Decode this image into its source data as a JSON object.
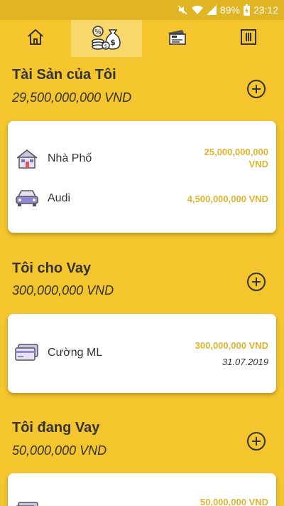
{
  "status_bar": {
    "battery": "89%",
    "time": "23:12"
  },
  "tabs": [
    {
      "icon": "home-icon"
    },
    {
      "icon": "assets-money-icon"
    },
    {
      "icon": "ticket-icon"
    },
    {
      "icon": "menu-columns-icon"
    }
  ],
  "assets": {
    "title": "Tài Sản của Tôi",
    "total": "29,500,000,000 VND",
    "items": [
      {
        "name": "Nhà Phố",
        "amount_line1": "25,000,000,000",
        "amount_line2": "VND",
        "icon": "house-icon"
      },
      {
        "name": "Audi",
        "amount": "4,500,000,000 VND",
        "icon": "car-icon"
      }
    ]
  },
  "lending": {
    "title": "Tôi cho Vay",
    "total": "300,000,000 VND",
    "items": [
      {
        "name": "Cường ML",
        "amount": "300,000,000 VND",
        "date": "31.07.2019",
        "icon": "credit-card-icon"
      }
    ]
  },
  "borrowing": {
    "title": "Tôi đang Vay",
    "total": "50,000,000 VND",
    "items": [
      {
        "amount": "50,000,000 VND"
      }
    ]
  }
}
